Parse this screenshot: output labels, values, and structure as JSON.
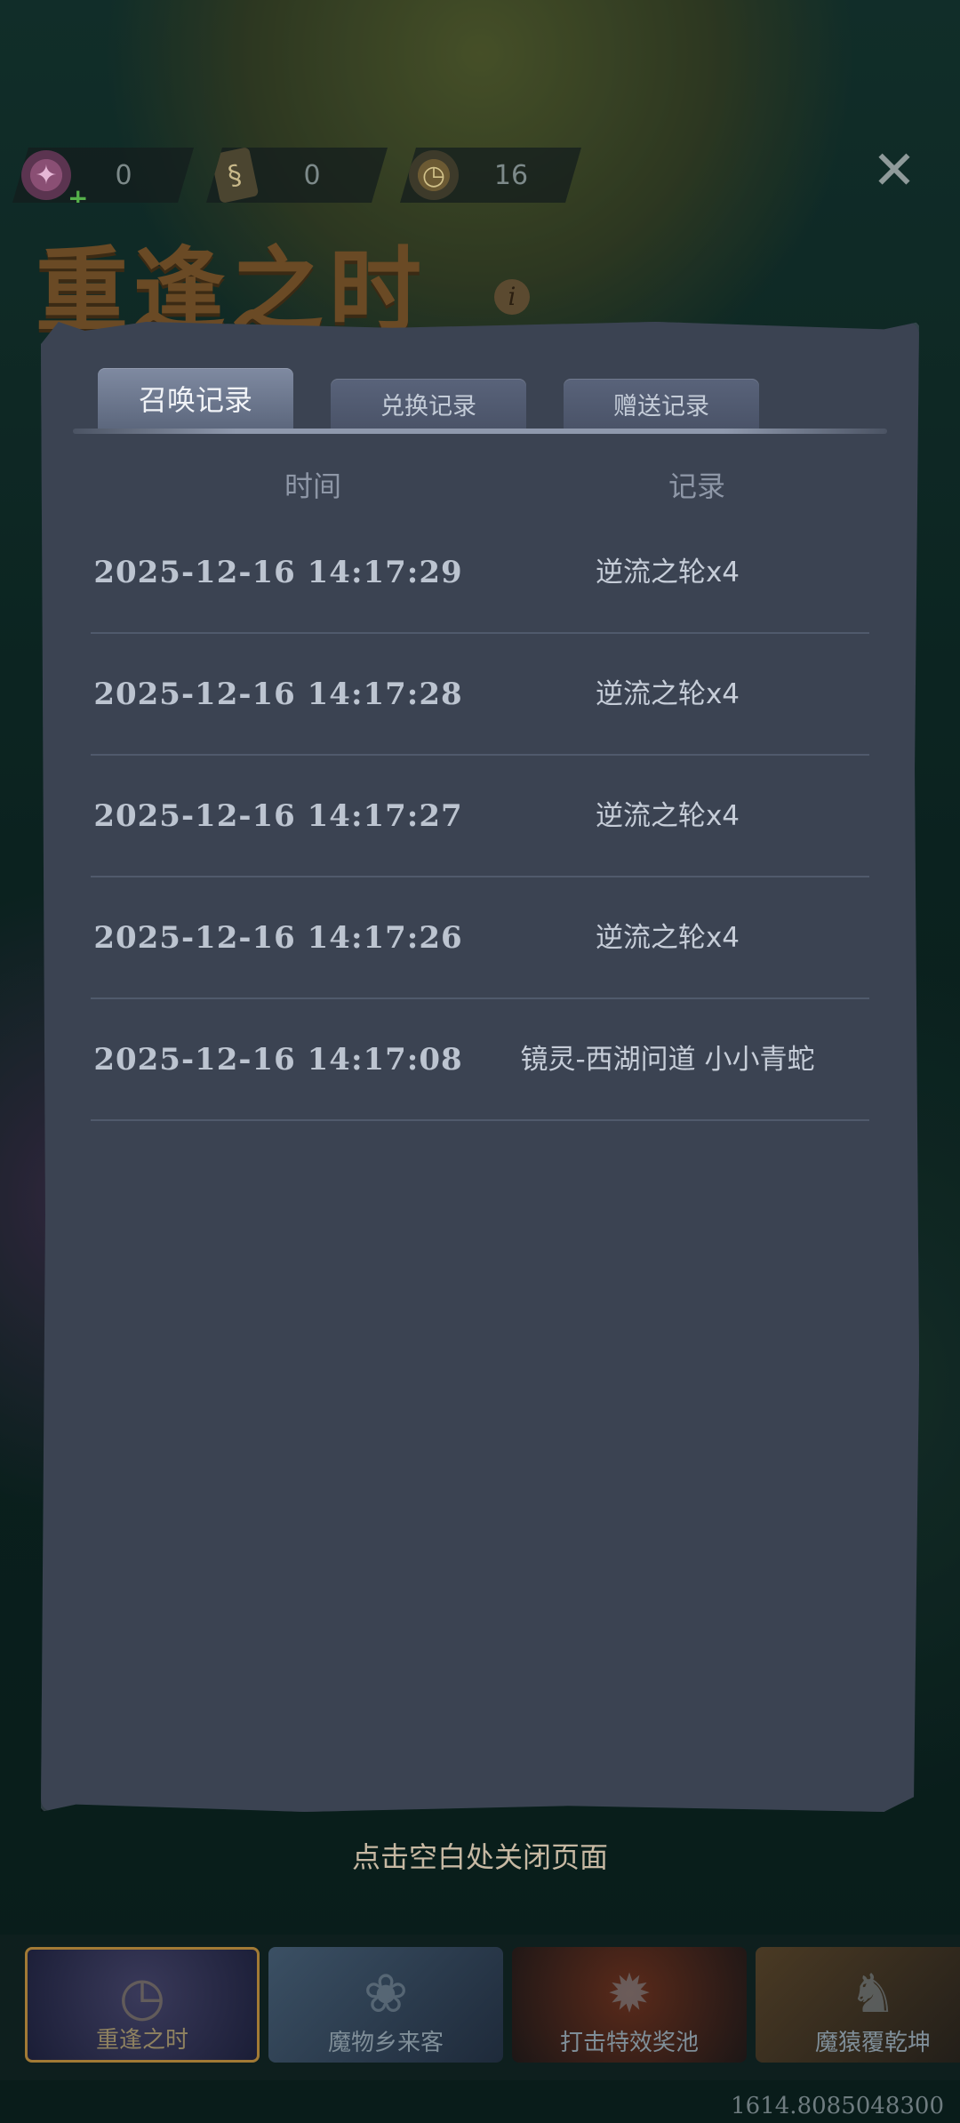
{
  "currencies": [
    {
      "icon": "candy-icon",
      "value": "0"
    },
    {
      "icon": "book-icon",
      "value": "0"
    },
    {
      "icon": "pocket-watch-icon",
      "value": "16"
    }
  ],
  "event": {
    "title": "重逢之时",
    "info": "i"
  },
  "modal": {
    "tabs": [
      {
        "label": "召唤记录",
        "active": true
      },
      {
        "label": "兑换记录",
        "active": false
      },
      {
        "label": "赠送记录",
        "active": false
      }
    ],
    "columns": {
      "time": "时间",
      "record": "记录"
    },
    "rows": [
      {
        "time": "2025-12-16 14:17:29",
        "record": "逆流之轮x4"
      },
      {
        "time": "2025-12-16 14:17:28",
        "record": "逆流之轮x4"
      },
      {
        "time": "2025-12-16 14:17:27",
        "record": "逆流之轮x4"
      },
      {
        "time": "2025-12-16 14:17:26",
        "record": "逆流之轮x4"
      },
      {
        "time": "2025-12-16 14:17:08",
        "record": "镜灵-西湖问道 小小青蛇"
      }
    ]
  },
  "dismiss_hint": "点击空白处关闭页面",
  "banners": [
    {
      "label": "重逢之时",
      "active": true
    },
    {
      "label": "魔物乡来客",
      "active": false
    },
    {
      "label": "打击特效奖池",
      "active": false
    },
    {
      "label": "魔猿覆乾坤",
      "active": false
    }
  ],
  "footer_id": "1614.8085048300"
}
